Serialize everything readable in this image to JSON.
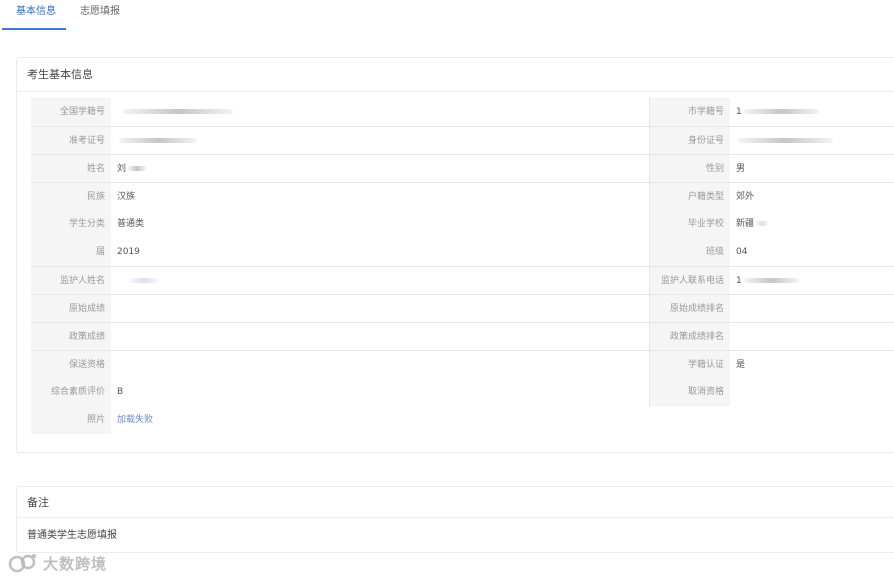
{
  "tabs": [
    {
      "label": "基本信息",
      "active": true
    },
    {
      "label": "志愿填报",
      "active": false
    }
  ],
  "basic_card": {
    "title": "考生基本信息",
    "rows": [
      {
        "l1": "全国学籍号",
        "v1": "",
        "l2": "市学籍号",
        "v2": "1"
      },
      {
        "l1": "准考证号",
        "v1": "",
        "l2": "身份证号",
        "v2": ""
      },
      {
        "l1": "姓名",
        "v1": "刘",
        "l2": "性别",
        "v2": "男"
      },
      {
        "l1": "民族",
        "v1": "汉族",
        "l2": "户籍类型",
        "v2": "郊外"
      },
      {
        "l1": "学生分类",
        "v1": "普通类",
        "l2": "毕业学校",
        "v2": "新疆"
      },
      {
        "l1": "届",
        "v1": "2019",
        "l2": "班级",
        "v2": "04"
      },
      {
        "l1": "监护人姓名",
        "v1": "",
        "l2": "监护人联系电话",
        "v2": "1"
      },
      {
        "l1": "原始成绩",
        "v1": "",
        "l2": "原始成绩排名",
        "v2": ""
      },
      {
        "l1": "政策成绩",
        "v1": "",
        "l2": "政策成绩排名",
        "v2": ""
      },
      {
        "l1": "保送资格",
        "v1": "",
        "l2": "学籍认证",
        "v2": "是"
      },
      {
        "l1": "综合素质评价",
        "v1": "B",
        "l2": "取消资格",
        "v2": ""
      },
      {
        "l1": "照片",
        "v1": "加载失败",
        "l2": "",
        "v2": ""
      }
    ]
  },
  "remark_card": {
    "title": "备注",
    "text": "普通类学生志愿填报"
  },
  "watermark": {
    "text": "大数跨境"
  },
  "colors": {
    "accent": "#3a7ad6",
    "label_bg": "#f5f5f5",
    "link": "#6a8cc7"
  }
}
